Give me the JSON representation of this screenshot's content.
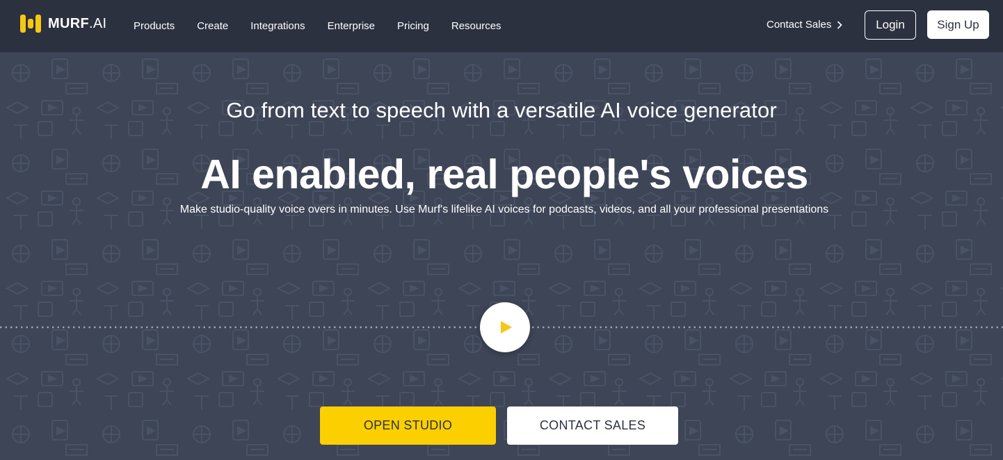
{
  "nav": {
    "logo_text_bold": "MURF",
    "logo_text_light": ".AI",
    "links": [
      "Products",
      "Create",
      "Integrations",
      "Enterprise",
      "Pricing",
      "Resources"
    ],
    "contact_sales": "Contact Sales",
    "login": "Login",
    "signup": "Sign Up"
  },
  "hero": {
    "subtitle": "Go from text to speech with a versatile AI voice generator",
    "headline": "AI enabled, real people's voices",
    "description": "Make studio-quality voice overs in minutes. Use Murf's lifelike AI voices for podcasts, videos, and all your professional presentations",
    "play_icon": "play-icon",
    "primary_cta": "OPEN STUDIO",
    "secondary_cta": "CONTACT SALES"
  },
  "colors": {
    "nav_bg": "#2c3140",
    "hero_bg": "#3d4556",
    "accent": "#fccf00",
    "logo_yellow": "#f6c813"
  }
}
